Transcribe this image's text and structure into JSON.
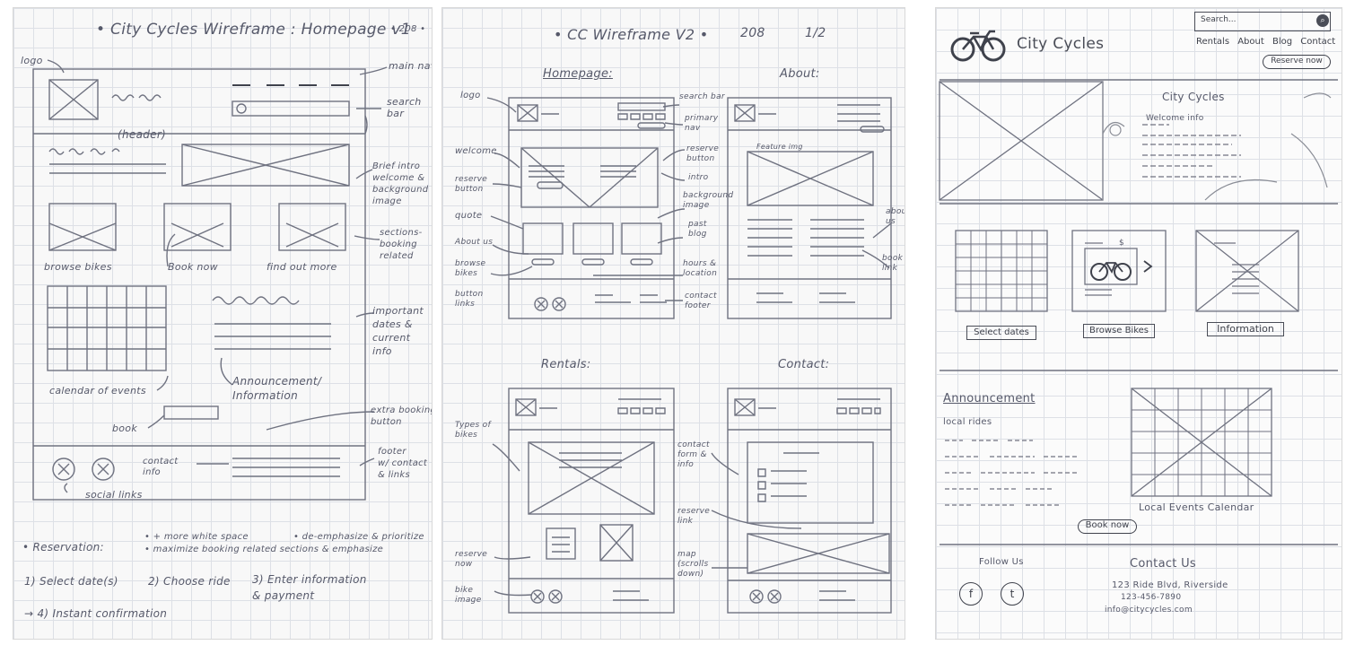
{
  "sheet1": {
    "title": "• City Cycles Wireframe : Homepage v1",
    "page": "• 208 •",
    "annotations": {
      "logo": "logo",
      "main_nav": "main nav",
      "search_bar": "search\nbar",
      "header": "(header)",
      "brief_intro": "Brief intro\nwelcome &\nbackground\nimage",
      "sections": "sections-\nbooking\nrelated",
      "browse_bikes": "browse bikes",
      "book_now": "Book now",
      "find_out_more": "find out more",
      "important_dates": "important\ndates &\ncurrent\ninfo",
      "announcement": "Announcement/\nInformation",
      "calendar": "calendar of events",
      "book": "book",
      "extra_booking": "extra booking\nbutton",
      "contact_info": "contact\ninfo",
      "footer": "footer\nw/ contact\n& links",
      "social_links": "social links"
    },
    "notes": {
      "reservation": "• Reservation:",
      "more_white_space": "• + more white space",
      "deemphasize": "• de-emphasize & prioritize",
      "maximize": "• maximize booking related sections & emphasize",
      "step1": "1) Select date(s)",
      "step2": "2) Choose ride",
      "step3": "3) Enter information\n& payment",
      "step4": "→ 4) Instant confirmation"
    }
  },
  "sheet2": {
    "title": "• CC Wireframe V2 •",
    "page": "208",
    "page_count": "1/2",
    "section_titles": {
      "homepage": "Homepage:",
      "about": "About:",
      "rentals": "Rentals:",
      "contact": "Contact:"
    },
    "annotations_left": {
      "logo": "logo",
      "welcome": "welcome",
      "reserve_button": "reserve\nbutton",
      "quote": "quote",
      "about_us": "About us",
      "browse_bikes": "browse\nbikes",
      "button_links": "button\nlinks",
      "types_of_bikes": "Types of\nbikes",
      "reserve_now": "reserve\nnow",
      "bike_image": "bike\nimage",
      "contact_form": "contact\nform &\ninfo",
      "reserve_link": "reserve\nlink",
      "map": "map\n(scrolls\ndown)"
    },
    "annotations_right": {
      "search_bar": "search bar",
      "primary_nav": "primary\nnav",
      "reserve_button": "reserve\nbutton",
      "intro": "intro",
      "background_image": "background\nimage",
      "past_blog": "past\nblog",
      "hours_location": "hours &\nlocation",
      "contact_footer": "contact\nfooter",
      "about_us": "about\nus",
      "book_link": "book\nlink"
    },
    "about_image_label": "Feature img"
  },
  "sheet3": {
    "brand": "City Cycles",
    "search_placeholder": "Search...",
    "nav": [
      "Rentals",
      "About",
      "Blog",
      "Contact"
    ],
    "reserve_button": "Reserve now",
    "hero_title": "City Cycles",
    "hero_welcome": "Welcome info",
    "cards": [
      {
        "label": "Select dates"
      },
      {
        "label": "Browse Bikes"
      },
      {
        "label": "Information"
      }
    ],
    "price_symbol": "$",
    "announcement_title": "Announcement",
    "announcement_line": "local rides",
    "calendar_label": "Local Events Calendar",
    "book_button": "Book now",
    "follow_us": "Follow Us",
    "social": [
      "f",
      "t"
    ],
    "contact_title": "Contact Us",
    "contact_lines": [
      "123 Ride Blvd, Riverside",
      "123-456-7890",
      "info@citycycles.com"
    ]
  }
}
